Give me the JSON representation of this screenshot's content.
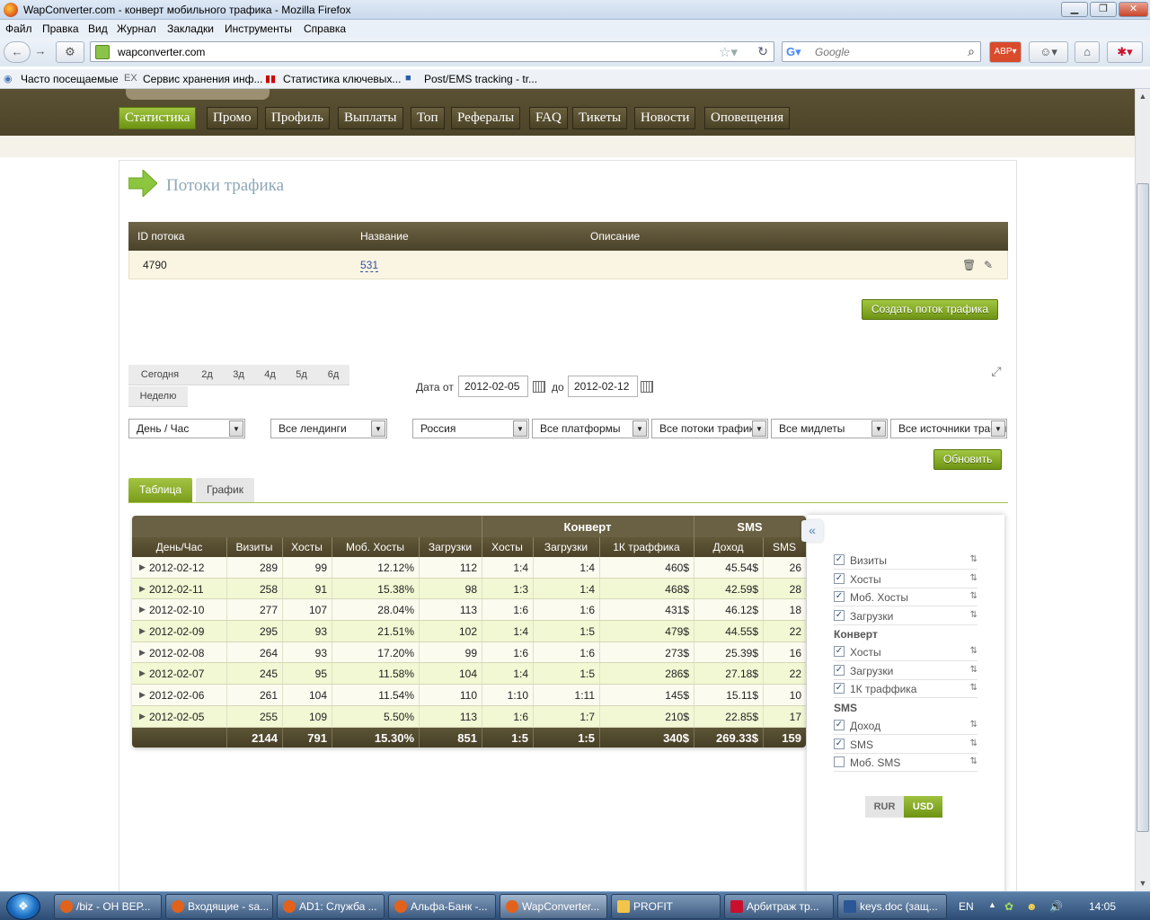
{
  "window": {
    "title": "WapConverter.com - конверт мобильного трафика - Mozilla Firefox",
    "btn_min": "▁",
    "btn_max": "❐",
    "btn_close": "✕"
  },
  "menu": [
    "Файл",
    "Правка",
    "Вид",
    "Журнал",
    "Закладки",
    "Инструменты",
    "Справка"
  ],
  "toolbar": {
    "url": "wapconverter.com",
    "search_placeholder": "Google"
  },
  "bookmarks": [
    "Часто посещаемые",
    "Сервис хранения инф...",
    "Статистика ключевых...",
    "Post/EMS tracking - tr..."
  ],
  "site_nav": [
    "Статистика",
    "Промо",
    "Профиль",
    "Выплаты",
    "Топ",
    "Рефералы",
    "FAQ",
    "Тикеты",
    "Новости",
    "Оповещения"
  ],
  "page": {
    "heading": "Потоки трафика",
    "streams_headers": [
      "ID потока",
      "Название",
      "Описание"
    ],
    "stream_row": {
      "id": "4790",
      "name": "531",
      "description": ""
    },
    "create_button": "Создать поток трафика",
    "periods": [
      "Сегодня",
      "2д",
      "3д",
      "4д",
      "5д",
      "6д",
      "Неделю"
    ],
    "date_from_label": "Дата от",
    "date_from": "2012-02-05",
    "date_to_label": "до",
    "date_to": "2012-02-12",
    "filters": [
      "День / Час",
      "Все лендинги",
      "Россия",
      "Все платформы",
      "Все потоки трафика",
      "Все мидлеты",
      "Все источники трафика"
    ],
    "update_button": "Обновить",
    "tabs": [
      "Таблица",
      "График"
    ]
  },
  "stats": {
    "group_headers": [
      "Конверт",
      "SMS"
    ],
    "columns": [
      "День/Час",
      "Визиты",
      "Хосты",
      "Моб. Хосты",
      "Загрузки",
      "Хосты",
      "Загрузки",
      "1К траффика",
      "Доход",
      "SMS"
    ],
    "rows": [
      [
        "2012-02-12",
        "289",
        "99",
        "12.12%",
        "112",
        "1:4",
        "1:4",
        "460$",
        "45.54$",
        "26"
      ],
      [
        "2012-02-11",
        "258",
        "91",
        "15.38%",
        "98",
        "1:3",
        "1:4",
        "468$",
        "42.59$",
        "28"
      ],
      [
        "2012-02-10",
        "277",
        "107",
        "28.04%",
        "113",
        "1:6",
        "1:6",
        "431$",
        "46.12$",
        "18"
      ],
      [
        "2012-02-09",
        "295",
        "93",
        "21.51%",
        "102",
        "1:4",
        "1:5",
        "479$",
        "44.55$",
        "22"
      ],
      [
        "2012-02-08",
        "264",
        "93",
        "17.20%",
        "99",
        "1:6",
        "1:6",
        "273$",
        "25.39$",
        "16"
      ],
      [
        "2012-02-07",
        "245",
        "95",
        "11.58%",
        "104",
        "1:4",
        "1:5",
        "286$",
        "27.18$",
        "22"
      ],
      [
        "2012-02-06",
        "261",
        "104",
        "11.54%",
        "110",
        "1:10",
        "1:11",
        "145$",
        "15.11$",
        "10"
      ],
      [
        "2012-02-05",
        "255",
        "109",
        "5.50%",
        "113",
        "1:6",
        "1:7",
        "210$",
        "22.85$",
        "17"
      ]
    ],
    "totals": [
      "",
      "2144",
      "791",
      "15.30%",
      "851",
      "1:5",
      "1:5",
      "340$",
      "269.33$",
      "159"
    ]
  },
  "picker": {
    "items_main": [
      {
        "label": "Визиты",
        "checked": true
      },
      {
        "label": "Хосты",
        "checked": true
      },
      {
        "label": "Моб. Хосты",
        "checked": true
      },
      {
        "label": "Загрузки",
        "checked": true
      }
    ],
    "group_convert": "Конверт",
    "items_convert": [
      {
        "label": "Хосты",
        "checked": true
      },
      {
        "label": "Загрузки",
        "checked": true
      },
      {
        "label": "1К траффика",
        "checked": true
      }
    ],
    "group_sms": "SMS",
    "items_sms": [
      {
        "label": "Доход",
        "checked": true
      },
      {
        "label": "SMS",
        "checked": true
      },
      {
        "label": "Моб. SMS",
        "checked": false
      }
    ],
    "currency": [
      "RUR",
      "USD"
    ],
    "currency_selected": "USD"
  },
  "taskbar": {
    "tasks": [
      "/biz - ОН ВЕР...",
      "Входящие - sa...",
      "AD1: Служба ...",
      "Альфа-Банк -...",
      "WapConverter...",
      "PROFIT",
      "Арбитраж тр...",
      "keys.doc (защ..."
    ],
    "lang": "EN",
    "time": "14:05"
  },
  "colors": {
    "accent_green": "#8bb22a",
    "header_brown": "#544a2f",
    "heading_blue": "#8ea7b8"
  }
}
